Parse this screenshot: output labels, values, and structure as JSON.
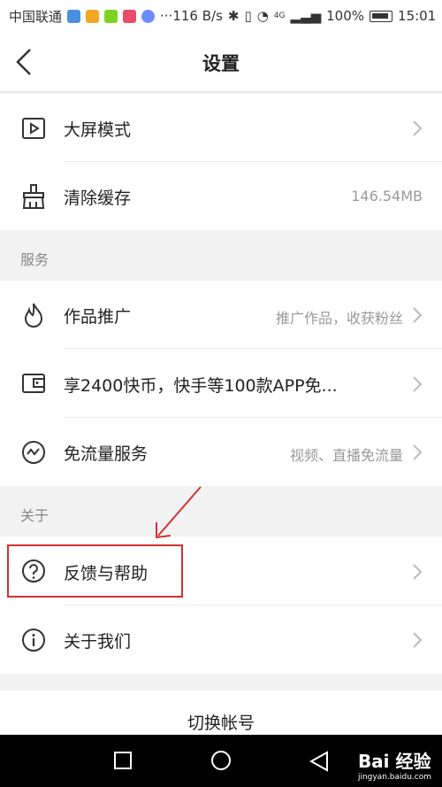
{
  "status_bar": {
    "carrier": "中国联通",
    "speed": "116 B/s",
    "network": "4G",
    "battery": "100%",
    "time": "15:01",
    "more": "···"
  },
  "header": {
    "title": "设置"
  },
  "rows": {
    "big_screen": {
      "label": "大屏模式"
    },
    "clear_cache": {
      "label": "清除缓存",
      "value": "146.54MB"
    },
    "promote": {
      "label": "作品推广",
      "value": "推广作品，收获粉丝"
    },
    "coins": {
      "label": "享2400快币，快手等100款APP免..."
    },
    "free_data": {
      "label": "免流量服务",
      "value": "视频、直播免流量"
    },
    "feedback": {
      "label": "反馈与帮助"
    },
    "about_us": {
      "label": "关于我们"
    }
  },
  "sections": {
    "services": "服务",
    "about": "关于"
  },
  "switch_account": "切换帐号",
  "watermark": {
    "brand": "Bai 经验",
    "url": "jingyan.baidu.com"
  },
  "colors": {
    "highlight": "#d43030",
    "accent_divider": "#ececec"
  }
}
